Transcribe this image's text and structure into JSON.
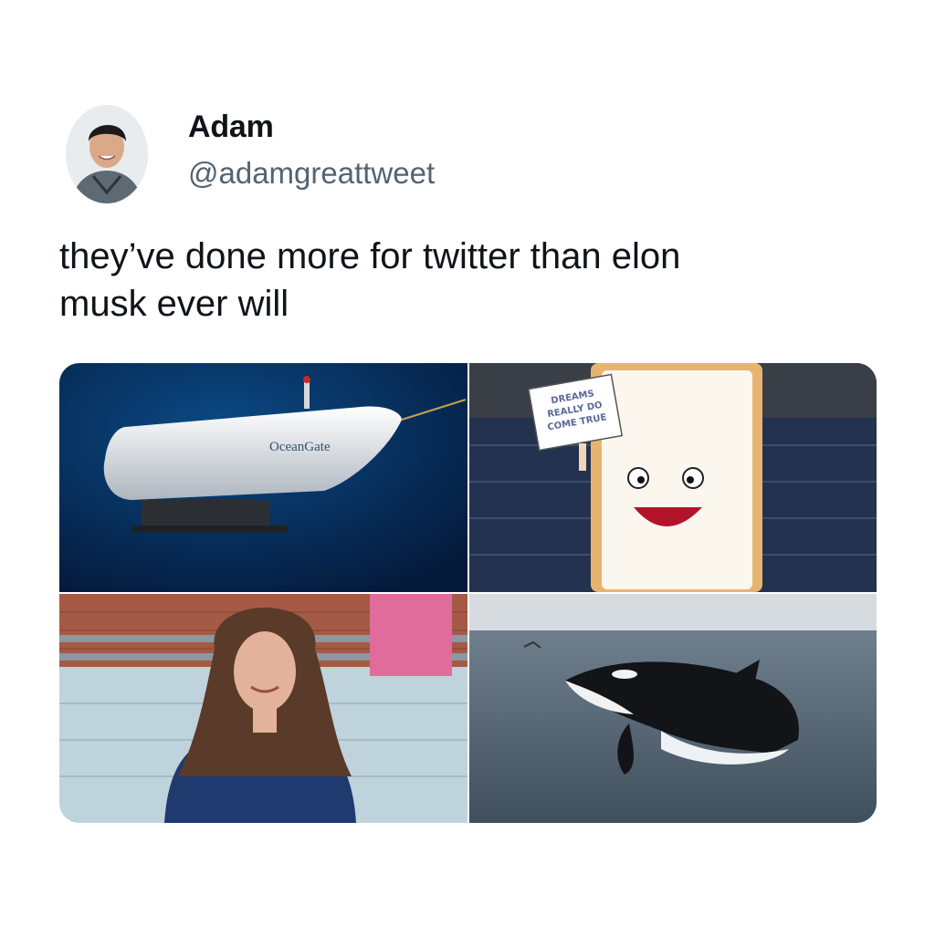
{
  "tweet": {
    "author": {
      "display_name": "Adam",
      "handle": "@adamgreattweet",
      "avatar_icon": "user-avatar-icon"
    },
    "text": "they’ve done more for twitter than elon\nmusk ever will",
    "media": [
      {
        "subject": "submersible",
        "brand_text": "OceanGate"
      },
      {
        "subject": "pastry-mascot",
        "sign_lines": [
          "DREAMS",
          "REALLY DO",
          "COME TRUE"
        ]
      },
      {
        "subject": "woman-portrait"
      },
      {
        "subject": "orca-breaching"
      }
    ]
  },
  "colors": {
    "text_primary": "#0f1419",
    "text_secondary": "#536471",
    "background": "#ffffff"
  }
}
